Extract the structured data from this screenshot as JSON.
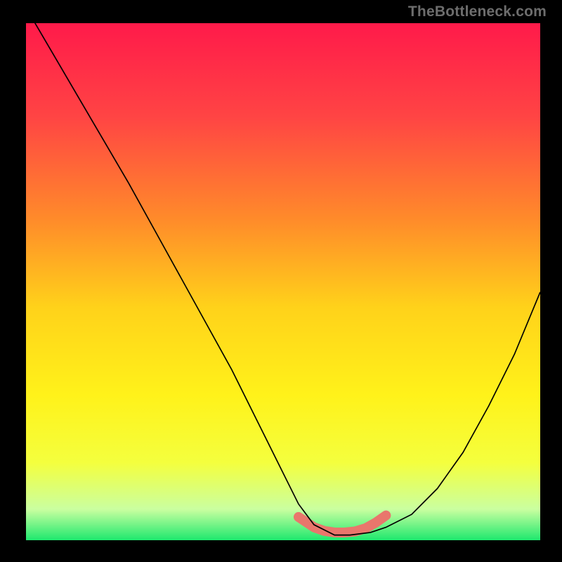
{
  "watermark": "TheBottleneck.com",
  "gradient": {
    "stops": [
      {
        "offset": 0.0,
        "color": "#ff1a4a"
      },
      {
        "offset": 0.18,
        "color": "#ff4444"
      },
      {
        "offset": 0.38,
        "color": "#ff8b2a"
      },
      {
        "offset": 0.55,
        "color": "#ffd21a"
      },
      {
        "offset": 0.72,
        "color": "#fff21a"
      },
      {
        "offset": 0.85,
        "color": "#f4ff3e"
      },
      {
        "offset": 0.94,
        "color": "#caffa0"
      },
      {
        "offset": 1.0,
        "color": "#1ee86e"
      }
    ]
  },
  "chart_data": {
    "type": "line",
    "title": "",
    "xlabel": "",
    "ylabel": "",
    "xlim": [
      0,
      100
    ],
    "ylim": [
      0,
      100
    ],
    "categories": [],
    "series": [
      {
        "name": "bottleneck-curve",
        "x": [
          0,
          5,
          10,
          15,
          20,
          25,
          30,
          35,
          40,
          45,
          50,
          53,
          56,
          60,
          63,
          67,
          70,
          75,
          80,
          85,
          90,
          95,
          100
        ],
        "y": [
          103,
          94.5,
          86,
          77.5,
          69,
          60,
          51,
          42,
          33,
          23,
          13,
          7,
          3,
          1,
          1,
          1.5,
          2.5,
          5,
          10,
          17,
          26,
          36,
          48
        ]
      }
    ],
    "highlight_band": {
      "x": [
        53,
        56,
        58,
        60,
        62,
        64,
        66,
        68,
        70
      ],
      "y": [
        4.5,
        2.5,
        1.8,
        1.5,
        1.5,
        1.7,
        2.3,
        3.4,
        4.8
      ],
      "color": "#e9766c"
    }
  }
}
